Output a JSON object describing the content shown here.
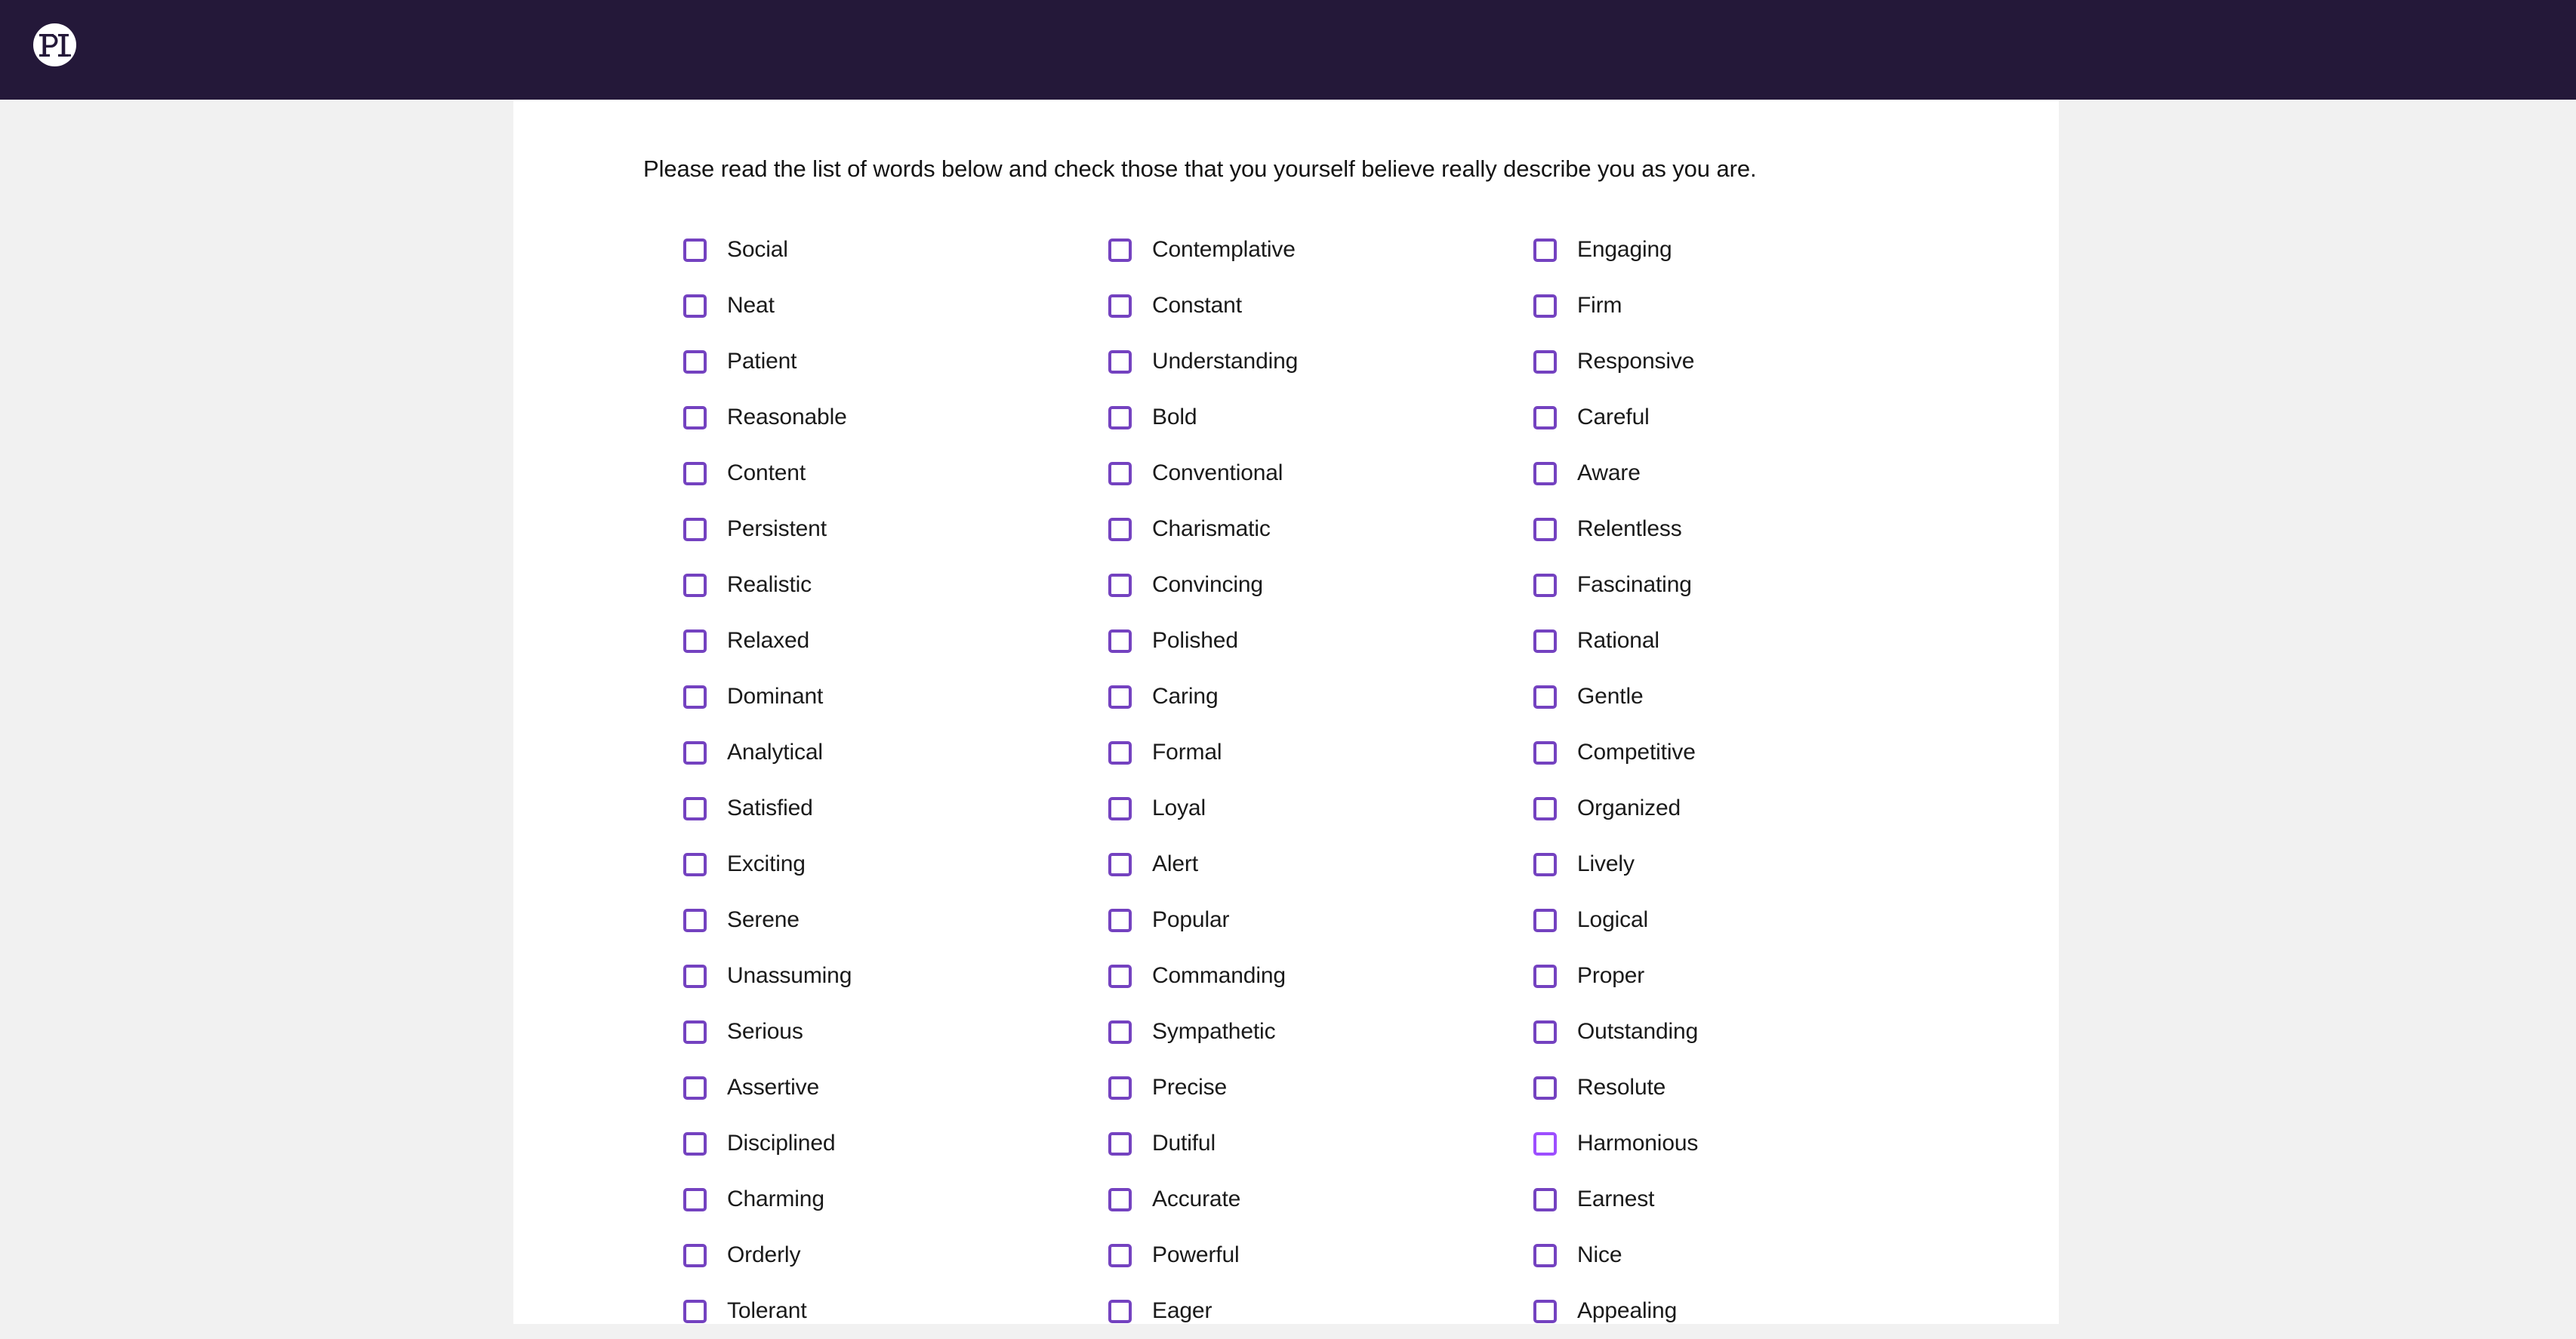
{
  "header": {
    "background_color": "#241839",
    "logo": {
      "name": "pi-logo",
      "text": "PI",
      "alt": "Predictive Index logo"
    }
  },
  "page": {
    "background_color": "#f1f1f1",
    "card_background_color": "#ffffff"
  },
  "main": {
    "instructions": "Please read the list of words below and check those that you yourself believe really describe you as you are.",
    "checkbox_color": "#7442c0",
    "checkbox_hover_color": "#9d4eff",
    "columns": [
      {
        "index": 1,
        "words": [
          {
            "label": "Social",
            "checked": false
          },
          {
            "label": "Neat",
            "checked": false
          },
          {
            "label": "Patient",
            "checked": false
          },
          {
            "label": "Reasonable",
            "checked": false
          },
          {
            "label": "Content",
            "checked": false
          },
          {
            "label": "Persistent",
            "checked": false
          },
          {
            "label": "Realistic",
            "checked": false
          },
          {
            "label": "Relaxed",
            "checked": false
          },
          {
            "label": "Dominant",
            "checked": false
          },
          {
            "label": "Analytical",
            "checked": false
          },
          {
            "label": "Satisfied",
            "checked": false
          },
          {
            "label": "Exciting",
            "checked": false
          },
          {
            "label": "Serene",
            "checked": false
          },
          {
            "label": "Unassuming",
            "checked": false
          },
          {
            "label": "Serious",
            "checked": false
          },
          {
            "label": "Assertive",
            "checked": false
          },
          {
            "label": "Disciplined",
            "checked": false
          },
          {
            "label": "Charming",
            "checked": false
          },
          {
            "label": "Orderly",
            "checked": false
          },
          {
            "label": "Tolerant",
            "checked": false
          }
        ]
      },
      {
        "index": 2,
        "words": [
          {
            "label": "Contemplative",
            "checked": false
          },
          {
            "label": "Constant",
            "checked": false
          },
          {
            "label": "Understanding",
            "checked": false
          },
          {
            "label": "Bold",
            "checked": false
          },
          {
            "label": "Conventional",
            "checked": false
          },
          {
            "label": "Charismatic",
            "checked": false
          },
          {
            "label": "Convincing",
            "checked": false
          },
          {
            "label": "Polished",
            "checked": false
          },
          {
            "label": "Caring",
            "checked": false
          },
          {
            "label": "Formal",
            "checked": false
          },
          {
            "label": "Loyal",
            "checked": false
          },
          {
            "label": "Alert",
            "checked": false
          },
          {
            "label": "Popular",
            "checked": false
          },
          {
            "label": "Commanding",
            "checked": false
          },
          {
            "label": "Sympathetic",
            "checked": false
          },
          {
            "label": "Precise",
            "checked": false
          },
          {
            "label": "Dutiful",
            "checked": false
          },
          {
            "label": "Accurate",
            "checked": false
          },
          {
            "label": "Powerful",
            "checked": false
          },
          {
            "label": "Eager",
            "checked": false
          }
        ]
      },
      {
        "index": 3,
        "words": [
          {
            "label": "Engaging",
            "checked": false
          },
          {
            "label": "Firm",
            "checked": false
          },
          {
            "label": "Responsive",
            "checked": false
          },
          {
            "label": "Careful",
            "checked": false
          },
          {
            "label": "Aware",
            "checked": false
          },
          {
            "label": "Relentless",
            "checked": false
          },
          {
            "label": "Fascinating",
            "checked": false
          },
          {
            "label": "Rational",
            "checked": false
          },
          {
            "label": "Gentle",
            "checked": false
          },
          {
            "label": "Competitive",
            "checked": false
          },
          {
            "label": "Organized",
            "checked": false
          },
          {
            "label": "Lively",
            "checked": false
          },
          {
            "label": "Logical",
            "checked": false
          },
          {
            "label": "Proper",
            "checked": false
          },
          {
            "label": "Outstanding",
            "checked": false
          },
          {
            "label": "Resolute",
            "checked": false
          },
          {
            "label": "Harmonious",
            "checked": false,
            "hovered": true
          },
          {
            "label": "Earnest",
            "checked": false
          },
          {
            "label": "Nice",
            "checked": false
          },
          {
            "label": "Appealing",
            "checked": false
          }
        ]
      }
    ]
  }
}
